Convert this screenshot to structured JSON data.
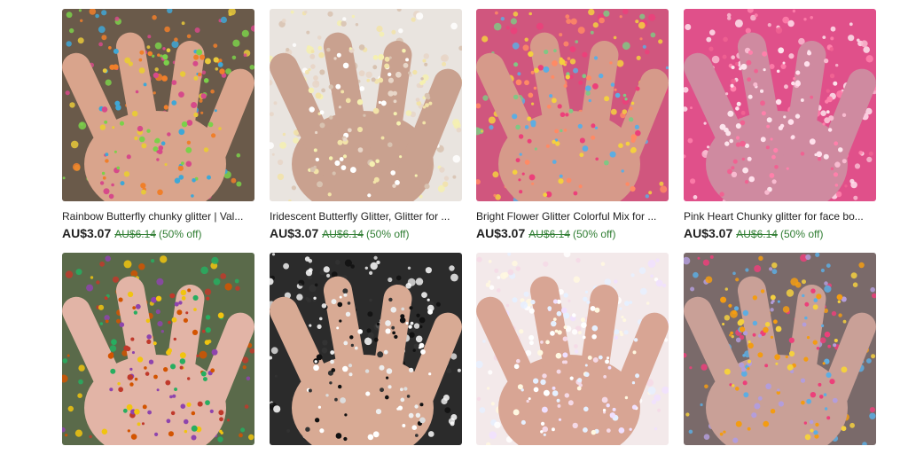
{
  "listings": [
    {
      "title": "Rainbow Butterfly chunky glitter | Val...",
      "price": "AU$3.07",
      "original_price": "AU$6.14",
      "discount": "(50% off)",
      "colors": {
        "bg": "#6a5a4a",
        "hand": "#d9a48c",
        "flecks": [
          "#e8c93a",
          "#3fa7d6",
          "#d64a8a",
          "#7bd14a",
          "#f07f2a"
        ]
      }
    },
    {
      "title": "Iridescent Butterfly Glitter, Glitter for ...",
      "price": "AU$3.07",
      "original_price": "AU$6.14",
      "discount": "(50% off)",
      "colors": {
        "bg": "#e9e4df",
        "hand": "#c9a18f",
        "flecks": [
          "#f2e3a8",
          "#e8d6c8",
          "#f5f0b0",
          "#ffffff",
          "#d8c2b0"
        ]
      }
    },
    {
      "title": "Bright Flower Glitter Colorful Mix for ...",
      "price": "AU$3.07",
      "original_price": "AU$6.14",
      "discount": "(50% off)",
      "colors": {
        "bg": "#d0567e",
        "hand": "#d69a8a",
        "flecks": [
          "#f4d03f",
          "#5dade2",
          "#ec407a",
          "#ff8a65",
          "#81c784"
        ]
      }
    },
    {
      "title": "Pink Heart Chunky glitter for face bo...",
      "price": "AU$3.07",
      "original_price": "AU$6.14",
      "discount": "(50% off)",
      "colors": {
        "bg": "#e0508a",
        "hand": "#cf8aa0",
        "flecks": [
          "#f8bbd0",
          "#f06292",
          "#ffe0ec",
          "#ff80ab",
          "#fce4ec"
        ]
      }
    },
    {
      "title": "",
      "price": "",
      "original_price": "",
      "discount": "",
      "colors": {
        "bg": "#5a6a4a",
        "hand": "#e2b4a6",
        "flecks": [
          "#c0392b",
          "#27ae60",
          "#f1c40f",
          "#8e44ad",
          "#d35400"
        ]
      }
    },
    {
      "title": "",
      "price": "",
      "original_price": "",
      "discount": "",
      "colors": {
        "bg": "#2b2b2b",
        "hand": "#d8aa94",
        "flecks": [
          "#ffffff",
          "#111111",
          "#eeeeee",
          "#333333",
          "#dddddd"
        ]
      }
    },
    {
      "title": "",
      "price": "",
      "original_price": "",
      "discount": "",
      "colors": {
        "bg": "#f3e9ea",
        "hand": "#d8a594",
        "flecks": [
          "#ffffff",
          "#f5d9e6",
          "#e6f0ff",
          "#fff8e1",
          "#f0e0ff"
        ]
      }
    },
    {
      "title": "",
      "price": "",
      "original_price": "",
      "discount": "",
      "colors": {
        "bg": "#7a6a6a",
        "hand": "#c9a097",
        "flecks": [
          "#f4d03f",
          "#5dade2",
          "#ec407a",
          "#f39c12",
          "#b39ddb"
        ]
      }
    }
  ],
  "icons": {
    "thumbnail": "glitter-photo"
  }
}
